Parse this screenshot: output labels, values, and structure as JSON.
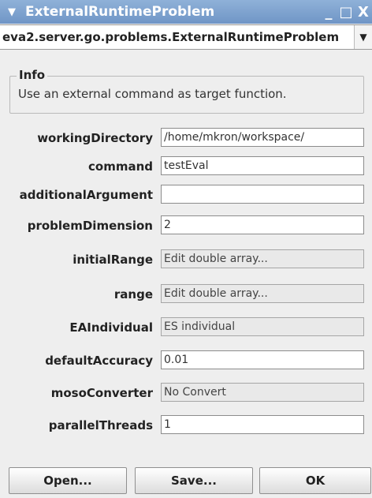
{
  "window": {
    "title": "ExternalRuntimeProblem",
    "menu_glyph": "▼",
    "minimize_glyph": "_",
    "maximize_glyph": "□",
    "close_glyph": "X"
  },
  "class_selector": {
    "value": "eva2.server.go.problems.ExternalRuntimeProblem",
    "arrow_glyph": "▼"
  },
  "info": {
    "legend": "Info",
    "text": "Use an external command as target function."
  },
  "properties": [
    {
      "label": "workingDirectory",
      "value": "/home/mkron/workspace/",
      "editable": true
    },
    {
      "label": "command",
      "value": "testEval",
      "editable": true
    },
    {
      "label": "additionalArgument",
      "value": "",
      "editable": true
    },
    {
      "label": "problemDimension",
      "value": "2",
      "editable": true
    },
    {
      "label": "initialRange",
      "value": "Edit double array...",
      "editable": false
    },
    {
      "label": "range",
      "value": "Edit double array...",
      "editable": false
    },
    {
      "label": "EAIndividual",
      "value": "ES individual",
      "editable": false
    },
    {
      "label": "defaultAccuracy",
      "value": "0.01",
      "editable": true
    },
    {
      "label": "mosoConverter",
      "value": "No Convert",
      "editable": false
    },
    {
      "label": "parallelThreads",
      "value": "1",
      "editable": true
    }
  ],
  "buttons": {
    "open": "Open...",
    "save": "Save...",
    "ok": "OK"
  }
}
